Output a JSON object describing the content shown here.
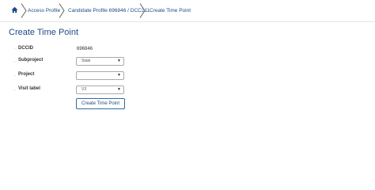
{
  "breadcrumb": {
    "home_icon": "home-icon",
    "items": [
      {
        "label": "Access Profile"
      },
      {
        "label": "Candidate Profile 696846 / DCC211"
      },
      {
        "label": "Create Time Point"
      }
    ]
  },
  "page": {
    "title": "Create Time Point"
  },
  "form": {
    "dccid": {
      "label": "DCCID",
      "value": "696846"
    },
    "subproject": {
      "label": "Subproject",
      "value": "Stale"
    },
    "project": {
      "label": "Project",
      "value": ""
    },
    "visit_label": {
      "label": "Visit label",
      "value": "V3"
    },
    "submit_label": "Create Time Point"
  },
  "colors": {
    "accent": "#1d4a86",
    "button_border": "#2e6da4"
  }
}
